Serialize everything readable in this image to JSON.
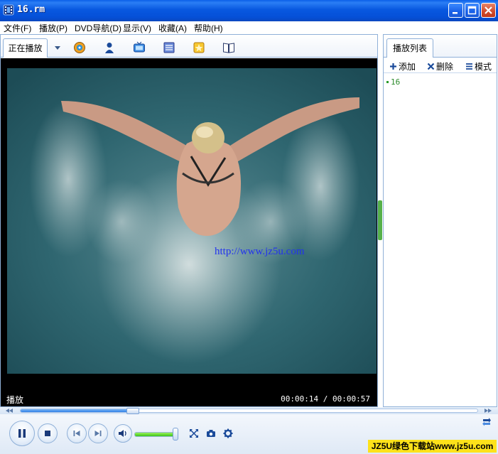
{
  "window": {
    "title": "16.rm",
    "icon": "film-reel-icon"
  },
  "menu": {
    "items": [
      "文件(F)",
      "播放(P)",
      "DVD导航(D)",
      "显示(V)",
      "收藏(A)",
      "帮助(H)"
    ]
  },
  "left_tabs": {
    "now_playing": "正在播放",
    "toolbar_icons": [
      "media-guide-icon",
      "user-icon",
      "tv-icon",
      "library-icon",
      "star-badge-icon",
      "book-icon"
    ]
  },
  "video": {
    "watermark": "http://www.jz5u.com",
    "state": "播放",
    "time": "00:00:14 / 00:00:57"
  },
  "playlist": {
    "tab": "播放列表",
    "add": "添加",
    "delete": "删除",
    "mode": "模式",
    "entries": [
      "16"
    ]
  },
  "seek": {
    "progress": 0.245
  },
  "volume": {
    "level": 0.95
  },
  "brand": "JZ5U绿色下载站www.jz5u.com",
  "colors": {
    "titlebar": "#0858e0",
    "accent": "#2f80e6",
    "volume": "#3cc41a",
    "brand_bg": "#fde21a"
  }
}
